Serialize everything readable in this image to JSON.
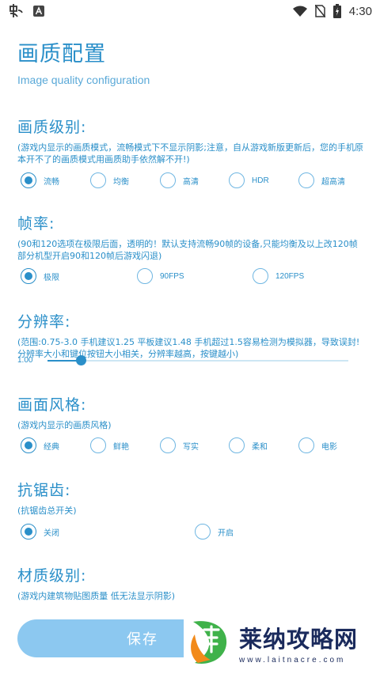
{
  "status_bar": {
    "time": "4:30",
    "icons": [
      "app-notification-icon",
      "a-notification-icon",
      "wifi-icon",
      "no-sim-icon",
      "battery-charging-icon"
    ]
  },
  "header": {
    "title": "画质配置",
    "subtitle": "Image quality configuration"
  },
  "quality": {
    "title": "画质级别:",
    "desc": "(游戏内显示的画质模式，流畅模式下不显示阴影;注意，自从游戏新版更新后，您的手机原本开不了的画质模式用画质助手依然解不开!)",
    "options": [
      "流畅",
      "均衡",
      "高清",
      "HDR",
      "超高清"
    ],
    "selected": "流畅"
  },
  "fps": {
    "title": "帧率:",
    "desc": "(90和120选项在极限后面，透明的！默认支持流畅90帧的设备,只能均衡及以上改120帧 部分机型开启90和120帧后游戏闪退)",
    "options": [
      "极限",
      "90FPS",
      "120FPS"
    ],
    "selected": "极限"
  },
  "resolution": {
    "title": "分辨率:",
    "desc": "(范围:0.75-3.0 手机建议1.25 平板建议1.48 手机超过1.5容易检测为模拟器，导致误封!分辨率大小和键位按钮大小相关，分辨率越高，按键越小)",
    "value": "1.00",
    "min": 0.75,
    "max": 3.0,
    "current": 1.0
  },
  "style": {
    "title": "画面风格:",
    "desc": "(游戏内显示的画质风格)",
    "options": [
      "经典",
      "鲜艳",
      "写实",
      "柔和",
      "电影"
    ],
    "selected": "经典"
  },
  "antialias": {
    "title": "抗锯齿:",
    "desc": "(抗锯齿总开关)",
    "options": [
      "关闭",
      "开启"
    ],
    "selected": "关闭"
  },
  "texture": {
    "title": "材质级别:",
    "desc": "(游戏内建筑物贴图质量 低无法显示阴影)"
  },
  "save": {
    "label": "保存"
  },
  "watermark": {
    "name": "莱纳攻略网",
    "url": "www.laitnacre.com"
  },
  "colors": {
    "accent": "#2a8fc9",
    "button": "#8cc8f0"
  }
}
